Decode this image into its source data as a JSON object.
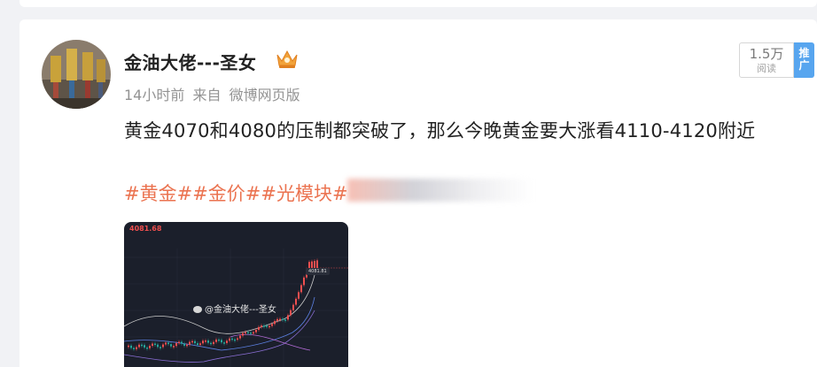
{
  "post": {
    "author": "金油大佬---圣女",
    "time": "14小时前",
    "source_prefix": "来自",
    "source": "微博网页版",
    "text": "黄金4070和4080的压制都突破了，那么今晚黄金要大涨看4110-4120附近",
    "tags": [
      "#黄金#",
      "#金价#",
      "#光模块#"
    ]
  },
  "stats": {
    "views_count": "1.5万",
    "views_label": "阅读",
    "promo_label": "推广"
  },
  "image": {
    "watermark": "@金油大佬---圣女",
    "chart_price": "4081.68",
    "price_tag": "4081.81"
  },
  "colors": {
    "tag": "#eb7350",
    "promo": "#57a5ef",
    "chart_bg": "#1b1f2b",
    "up": "#ef4f4f",
    "down": "#26a69a"
  },
  "icons": {
    "crown": "crown-icon",
    "weibo": "weibo-icon"
  }
}
